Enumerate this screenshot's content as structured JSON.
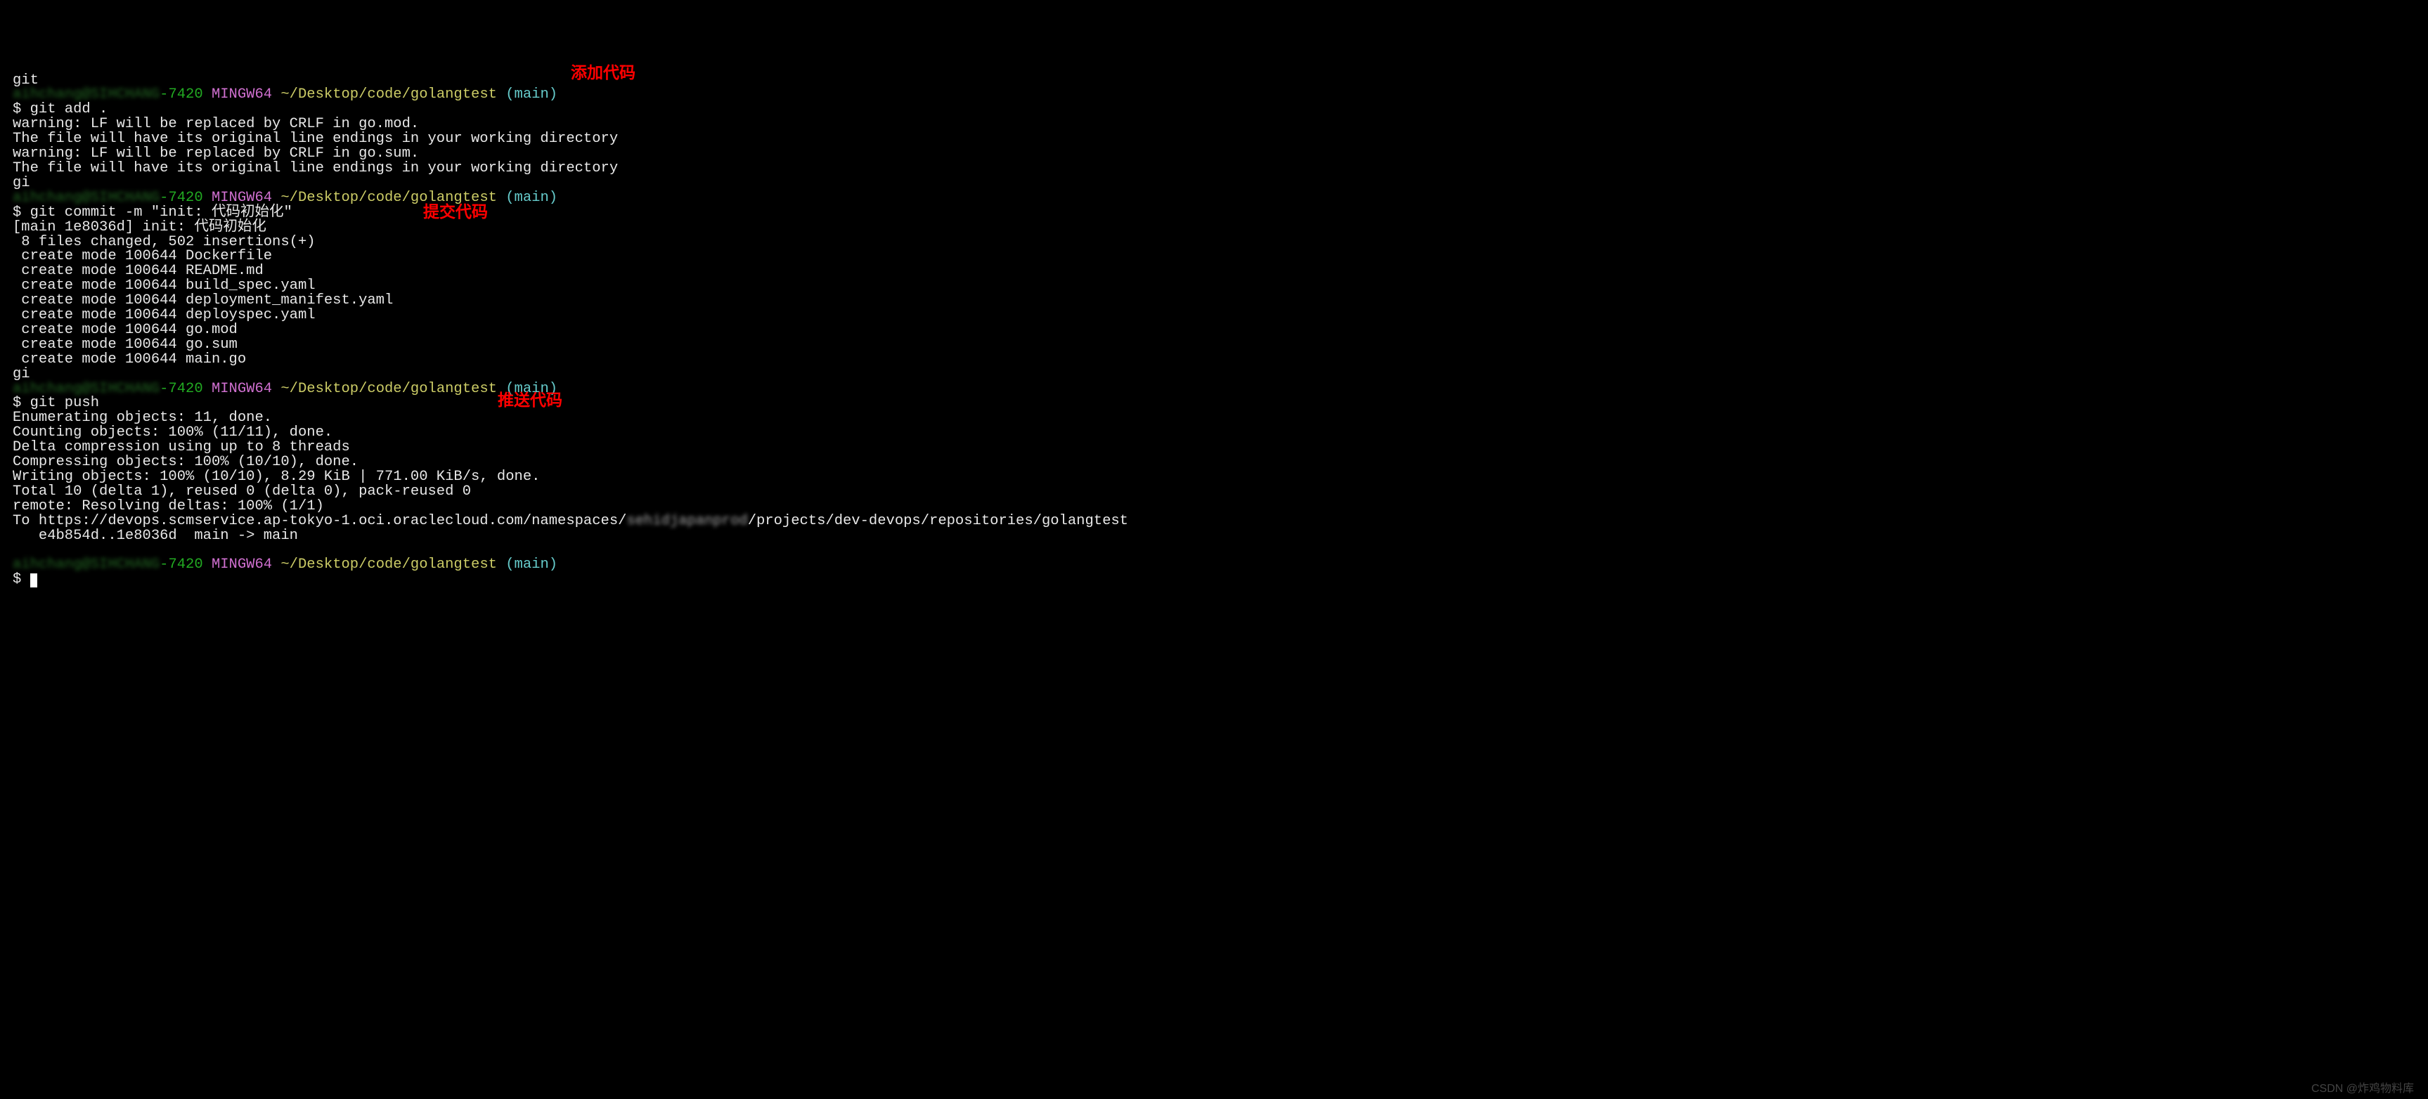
{
  "lines": {
    "l0": "git",
    "prompt1_user": "aihchang@SIHCHANG",
    "prompt1_host": "-7420",
    "prompt1_mingw": " MINGW64",
    "prompt1_path": " ~/Desktop/code/golangtest",
    "prompt1_branch": " (main)",
    "cmd1": "$ git add .",
    "warn1": "warning: LF will be replaced by CRLF in go.mod.",
    "warn2": "The file will have its original line endings in your working directory",
    "warn3": "warning: LF will be replaced by CRLF in go.sum.",
    "warn4": "The file will have its original line endings in your working directory",
    "gi1": "gi",
    "prompt2_user": "aihchang@SIHCHANG",
    "prompt2_host": "-7420",
    "prompt2_mingw": " MINGW64",
    "prompt2_path": " ~/Desktop/code/golangtest",
    "prompt2_branch": " (main)",
    "cmd2": "$ git commit -m \"init: 代码初始化\"",
    "commit1": "[main 1e8036d] init: 代码初始化",
    "commit2": " 8 files changed, 502 insertions(+)",
    "create1": " create mode 100644 Dockerfile",
    "create2": " create mode 100644 README.md",
    "create3": " create mode 100644 build_spec.yaml",
    "create4": " create mode 100644 deployment_manifest.yaml",
    "create5": " create mode 100644 deployspec.yaml",
    "create6": " create mode 100644 go.mod",
    "create7": " create mode 100644 go.sum",
    "create8": " create mode 100644 main.go",
    "gi2": "gi",
    "prompt3_user": "aihchang@SIHCHANG",
    "prompt3_host": "-7420",
    "prompt3_mingw": " MINGW64",
    "prompt3_path": " ~/Desktop/code/golangtest",
    "prompt3_branch": " (main)",
    "cmd3": "$ git push",
    "push1": "Enumerating objects: 11, done.",
    "push2": "Counting objects: 100% (11/11), done.",
    "push3": "Delta compression using up to 8 threads",
    "push4": "Compressing objects: 100% (10/10), done.",
    "push5": "Writing objects: 100% (10/10), 8.29 KiB | 771.00 KiB/s, done.",
    "push6": "Total 10 (delta 1), reused 0 (delta 0), pack-reused 0",
    "push7": "remote: Resolving deltas: 100% (1/1)",
    "push8a": "To https://devops.scmservice.ap-tokyo-1.oci.oraclecloud.com/namespaces/",
    "push8b": "sehidjapanprod",
    "push8c": "/projects/dev-devops/repositories/golangtest",
    "push9": "   e4b854d..1e8036d  main -> main",
    "blank": "",
    "prompt4_user": "aihchang@SIHCHANG",
    "prompt4_host": "-7420",
    "prompt4_mingw": " MINGW64",
    "prompt4_path": " ~/Desktop/code/golangtest",
    "prompt4_branch": " (main)",
    "cmd4": "$ "
  },
  "annotations": {
    "add": "添加代码",
    "commit": "提交代码",
    "push": "推送代码"
  },
  "watermark": "CSDN @炸鸡物料库"
}
